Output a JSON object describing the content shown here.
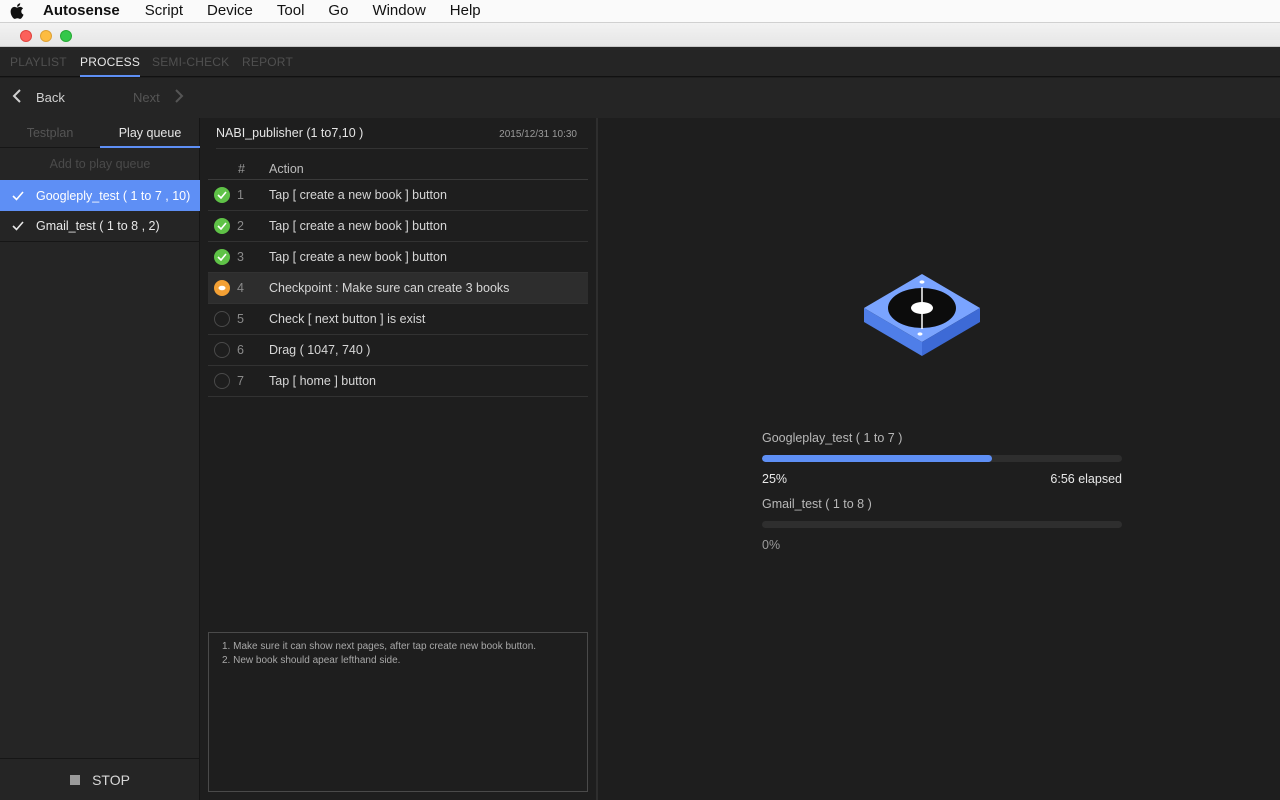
{
  "menubar": {
    "app_name": "Autosense",
    "items": [
      "Script",
      "Device",
      "Tool",
      "Go",
      "Window",
      "Help"
    ]
  },
  "top_tabs": [
    {
      "label": "PLAYLIST",
      "active": false
    },
    {
      "label": "PROCESS",
      "active": true
    },
    {
      "label": "SEMI-CHECK",
      "active": false
    },
    {
      "label": "REPORT",
      "active": false
    }
  ],
  "nav": {
    "back_label": "Back",
    "next_label": "Next"
  },
  "left_panel": {
    "tabs": [
      {
        "label": "Testplan",
        "active": false
      },
      {
        "label": "Play queue",
        "active": true
      }
    ],
    "add_label": "Add to play queue",
    "queue": [
      {
        "label": "Googleply_test ( 1 to 7 , 10)",
        "selected": true
      },
      {
        "label": "Gmail_test ( 1 to 8 , 2)",
        "selected": false
      }
    ],
    "stop_label": "STOP"
  },
  "middle_panel": {
    "title": "NABI_publisher (1 to7,10 )",
    "date": "2015/12/31 10:30",
    "columns": {
      "num": "#",
      "action": "Action"
    },
    "rows": [
      {
        "num": "1",
        "action": "Tap [ create a new book ] button",
        "status": "done"
      },
      {
        "num": "2",
        "action": "Tap [ create a new book ] button",
        "status": "done"
      },
      {
        "num": "3",
        "action": "Tap [ create a new book ] button",
        "status": "done"
      },
      {
        "num": "4",
        "action": "Checkpoint : Make sure can create 3 books",
        "status": "running"
      },
      {
        "num": "5",
        "action": "Check [ next button ] is exist",
        "status": "pending"
      },
      {
        "num": "6",
        "action": "Drag ( 1047, 740 )",
        "status": "pending"
      },
      {
        "num": "7",
        "action": "Tap [ home ] button",
        "status": "pending"
      }
    ],
    "notes": [
      "1. Make sure it can show next pages, after tap create new book button.",
      "2. New book should apear lefthand side."
    ]
  },
  "right_panel": {
    "progress": [
      {
        "name": "Googleplay_test ( 1 to 7 )",
        "percent_label": "25%",
        "fill_fraction": 0.64,
        "elapsed": "6:56 elapsed",
        "percent_color": "#e8e8e8"
      },
      {
        "name": "Gmail_test ( 1 to 8 )",
        "percent_label": "0%",
        "fill_fraction": 0.0,
        "elapsed": "",
        "percent_color": "#9a9a9a"
      }
    ]
  },
  "colors": {
    "accent": "#5e8ff5",
    "done": "#5fc247",
    "running": "#f3a034"
  }
}
